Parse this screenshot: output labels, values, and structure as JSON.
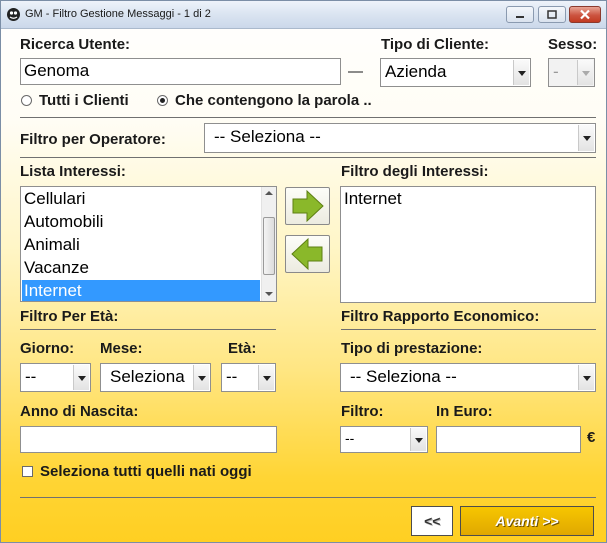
{
  "window": {
    "title": "GM - Filtro Gestione Messaggi - 1 di 2"
  },
  "ricerca": {
    "label": "Ricerca Utente:",
    "value": "Genoma",
    "dash": "—"
  },
  "tipo_cliente": {
    "label": "Tipo di Cliente:",
    "selected": "Azienda"
  },
  "sesso": {
    "label": "Sesso:",
    "selected": "-"
  },
  "search_mode": {
    "option_all": "Tutti i Clienti",
    "option_contains": "Che contengono la parola ..",
    "selected": "contains"
  },
  "operatore": {
    "label": "Filtro per Operatore:",
    "selected": "-- Seleziona --"
  },
  "interessi": {
    "list_label": "Lista Interessi:",
    "items": [
      "Cellulari",
      "Automobili",
      "Animali",
      "Vacanze",
      "Internet"
    ],
    "selected_index": 4,
    "filter_label": "Filtro degli Interessi:",
    "filter_items": [
      "Internet"
    ]
  },
  "eta": {
    "section_label": "Filtro Per Età:",
    "giorno_label": "Giorno:",
    "giorno_selected": "--",
    "mese_label": "Mese:",
    "mese_selected": "Seleziona",
    "eta_label": "Età:",
    "eta_selected": "--",
    "anno_label": "Anno di Nascita:",
    "anno_value": "",
    "oggi_label": "Seleziona tutti quelli nati oggi"
  },
  "economico": {
    "section_label": "Filtro Rapporto Economico:",
    "prestazione_label": "Tipo di prestazione:",
    "prestazione_selected": "-- Seleziona --",
    "filtro_label": "Filtro:",
    "filtro_selected": "--",
    "euro_label": "In Euro:",
    "euro_value": "",
    "euro_symbol": "€"
  },
  "navigation": {
    "back_label": "<<",
    "next_label": "Avanti >>"
  },
  "colors": {
    "selection": "#3399ff",
    "arrow_green": "#7fb21f",
    "next_button": "#e7b400"
  }
}
